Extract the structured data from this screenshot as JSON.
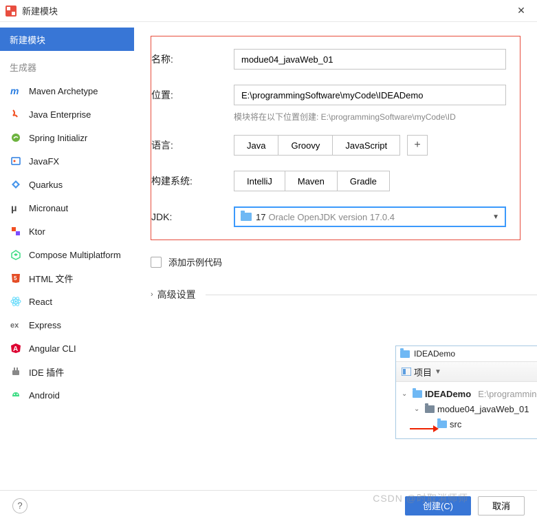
{
  "window": {
    "title": "新建模块"
  },
  "sidebar": {
    "selected_label": "新建模块",
    "generators_header": "生成器",
    "items": [
      {
        "label": "Maven Archetype",
        "icon": "maven",
        "color": "#2a7de1"
      },
      {
        "label": "Java Enterprise",
        "icon": "java-ee",
        "color": "#f25022"
      },
      {
        "label": "Spring Initializr",
        "icon": "spring",
        "color": "#6db33f"
      },
      {
        "label": "JavaFX",
        "icon": "javafx",
        "color": "#2a7de1"
      },
      {
        "label": "Quarkus",
        "icon": "quarkus",
        "color": "#4695eb"
      },
      {
        "label": "Micronaut",
        "icon": "micronaut",
        "color": "#444"
      },
      {
        "label": "Ktor",
        "icon": "ktor",
        "color": "#f25022"
      },
      {
        "label": "Compose Multiplatform",
        "icon": "compose",
        "color": "#3ddc84"
      },
      {
        "label": "HTML 文件",
        "icon": "html",
        "color": "#e44d26"
      },
      {
        "label": "React",
        "icon": "react",
        "color": "#61dafb"
      },
      {
        "label": "Express",
        "icon": "express",
        "color": "#6b6b6b"
      },
      {
        "label": "Angular CLI",
        "icon": "angular",
        "color": "#dd0031"
      },
      {
        "label": "IDE 插件",
        "icon": "plugin",
        "color": "#888"
      },
      {
        "label": "Android",
        "icon": "android",
        "color": "#3ddc84"
      }
    ]
  },
  "form": {
    "name_label": "名称:",
    "name_value": "modue04_javaWeb_01",
    "location_label": "位置:",
    "location_value": "E:\\programmingSoftware\\myCode\\IDEADemo",
    "location_hint": "模块将在以下位置创建: E:\\programmingSoftware\\myCode\\ID",
    "language_label": "语言:",
    "languages": [
      "Java",
      "Groovy",
      "JavaScript"
    ],
    "build_label": "构建系统:",
    "builds": [
      "IntelliJ",
      "Maven",
      "Gradle"
    ],
    "jdk_label": "JDK:",
    "jdk_version": "17",
    "jdk_desc": "Oracle OpenJDK version 17.0.4",
    "sample_code_label": "添加示例代码",
    "advanced_label": "高级设置"
  },
  "preview": {
    "title": "IDEADemo",
    "project_label": "项目",
    "root_name": "IDEADemo",
    "root_path": "E:\\programmingSo",
    "module_name": "modue04_javaWeb_01",
    "src_name": "src"
  },
  "footer": {
    "create_label": "创建(C)",
    "cancel_label": "取消"
  },
  "watermark": "CSDN @时取消师师"
}
